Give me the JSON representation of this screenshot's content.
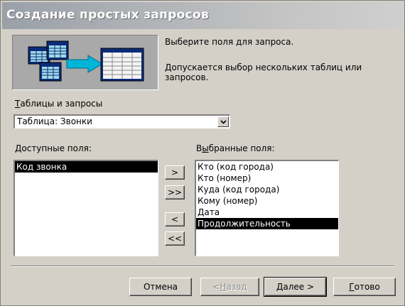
{
  "window": {
    "title": "Создание простых запросов"
  },
  "prompt": {
    "line1": "Выберите поля для запроса.",
    "line2": "Допускается выбор нескольких таблиц или запросов."
  },
  "tables": {
    "label_hotkey": "Т",
    "label_rest": "аблицы и запросы",
    "selected": "Таблица: Звонки"
  },
  "available": {
    "label_hotkey": "Д",
    "label_rest": "оступные поля:",
    "items": [
      "Код звонка"
    ],
    "selected_index": 0
  },
  "chosen": {
    "label_prefix": "В",
    "label_hotkey": "ы",
    "label_rest": "бранные поля:",
    "items": [
      "Кто (код города)",
      "Кто (номер)",
      "Куда (код города)",
      "Кому (номер)",
      "Дата",
      "Продолжительность"
    ],
    "selected_index": 5
  },
  "move": {
    "add_one": ">",
    "add_all": ">>",
    "remove_one": "<",
    "remove_all": "<<"
  },
  "footer": {
    "cancel": "Отмена",
    "back_prefix": "< ",
    "back_hotkey": "Н",
    "back_rest": "азад",
    "next_hotkey": "Д",
    "next_rest": "алее >",
    "finish_hotkey": "Г",
    "finish_rest": "отово"
  },
  "icons": {
    "dropdown": "chevron-down-icon",
    "illustration": "tables-to-query-illustration"
  },
  "colors": {
    "dialog_bg": "#d4d0c8",
    "selection": "#000000",
    "arrow": "#00b5d8"
  }
}
